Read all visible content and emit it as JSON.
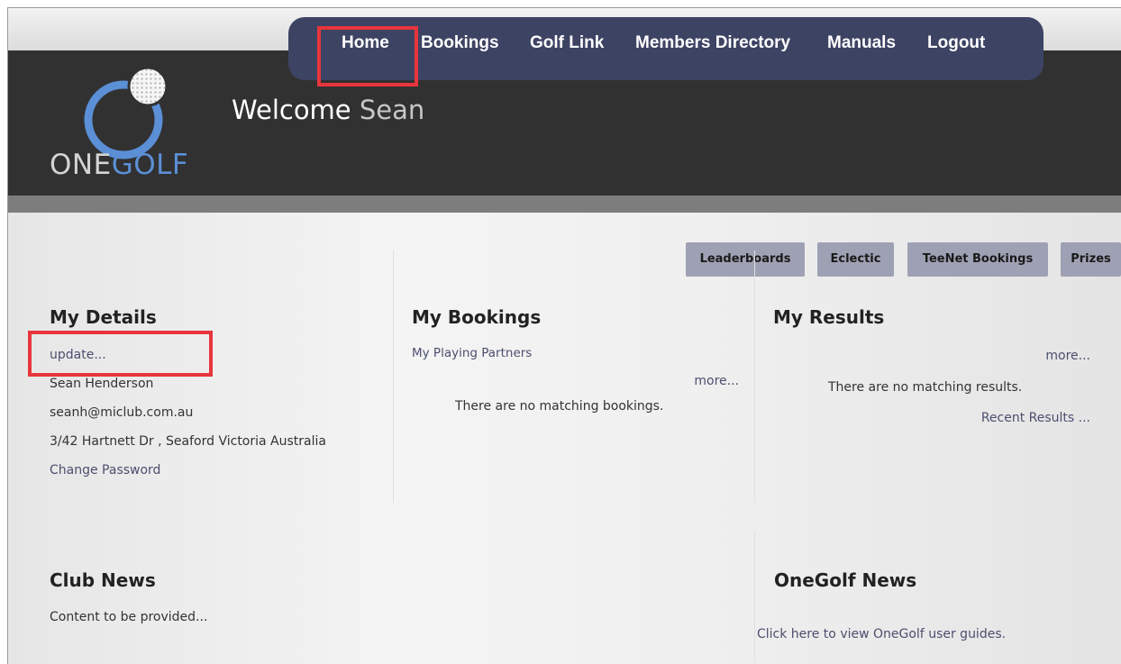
{
  "nav": {
    "items": [
      {
        "label": "Home"
      },
      {
        "label": "Bookings"
      },
      {
        "label": "Golf Link"
      },
      {
        "label": "Members Directory"
      },
      {
        "label": "Manuals"
      },
      {
        "label": "Logout"
      }
    ]
  },
  "logo": {
    "text_a": "ONE",
    "text_b": "GOLF"
  },
  "welcome": {
    "greeting": "Welcome",
    "name": "Sean"
  },
  "quick_links": [
    {
      "label": "Leaderboards"
    },
    {
      "label": "Eclectic"
    },
    {
      "label": "TeeNet Bookings"
    },
    {
      "label": "Prizes"
    }
  ],
  "my_details": {
    "title": "My Details",
    "update_link": "update...",
    "name": "Sean Henderson",
    "email": "seanh@miclub.com.au",
    "address": "3/42 Hartnett Dr , Seaford Victoria Australia",
    "change_password": "Change Password"
  },
  "my_bookings": {
    "title": "My Bookings",
    "partners_link": "My Playing Partners",
    "more": "more...",
    "empty": "There are no matching bookings."
  },
  "my_results": {
    "title": "My Results",
    "more": "more...",
    "empty": "There are no matching results.",
    "recent": "Recent Results ..."
  },
  "club_news": {
    "title": "Club News",
    "content": "Content to be provided..."
  },
  "onegolf_news": {
    "title": "OneGolf News",
    "link": "Click here to view OneGolf user guides."
  },
  "colors": {
    "navbar": "#3d4363",
    "header": "#313131",
    "highlight": "#e8353d",
    "logo_blue": "#5b8fd6",
    "button": "#9ea1b3"
  }
}
